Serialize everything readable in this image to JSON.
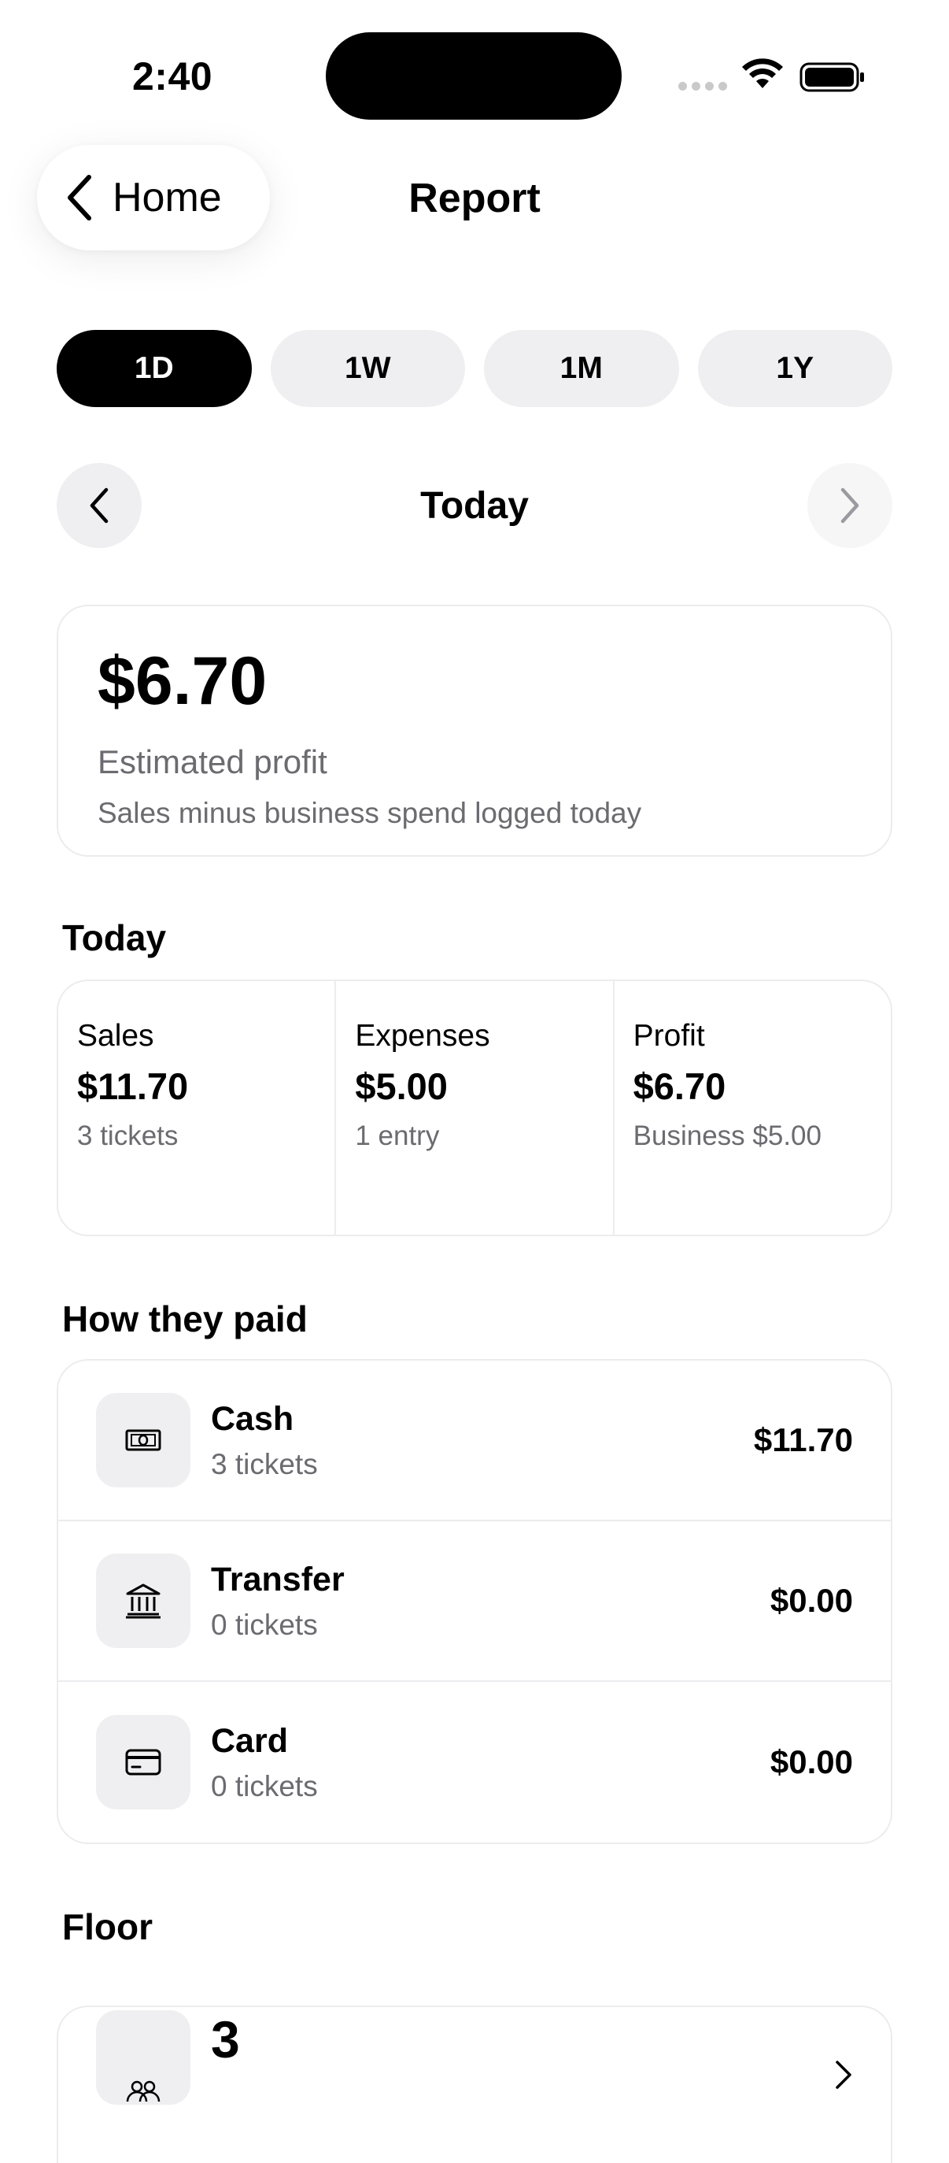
{
  "status_bar": {
    "time": "2:40"
  },
  "nav": {
    "back_label": "Home",
    "title": "Report"
  },
  "ranges": [
    {
      "label": "1D",
      "active": true
    },
    {
      "label": "1W",
      "active": false
    },
    {
      "label": "1M",
      "active": false
    },
    {
      "label": "1Y",
      "active": false
    }
  ],
  "date_nav": {
    "label": "Today",
    "next_disabled": true
  },
  "profit": {
    "amount": "$6.70",
    "label": "Estimated profit",
    "subtitle": "Sales minus business spend logged today"
  },
  "summary": {
    "title": "Today",
    "columns": [
      {
        "label": "Sales",
        "value": "$11.70",
        "note": "3 tickets"
      },
      {
        "label": "Expenses",
        "value": "$5.00",
        "note": "1 entry"
      },
      {
        "label": "Profit",
        "value": "$6.70",
        "note": "Business $5.00"
      }
    ]
  },
  "payments": {
    "title": "How they paid",
    "rows": [
      {
        "name": "Cash",
        "count": "3 tickets",
        "amount": "$11.70",
        "icon": "cash-icon"
      },
      {
        "name": "Transfer",
        "count": "0 tickets",
        "amount": "$0.00",
        "icon": "bank-icon"
      },
      {
        "name": "Card",
        "count": "0 tickets",
        "amount": "$0.00",
        "icon": "card-icon"
      }
    ]
  },
  "floor": {
    "title": "Floor",
    "value": "3",
    "icon": "people-icon"
  },
  "colors": {
    "accent": "#000000",
    "muted_text": "#6b6b70",
    "chip_bg": "#efeff1",
    "border": "#ececef"
  }
}
